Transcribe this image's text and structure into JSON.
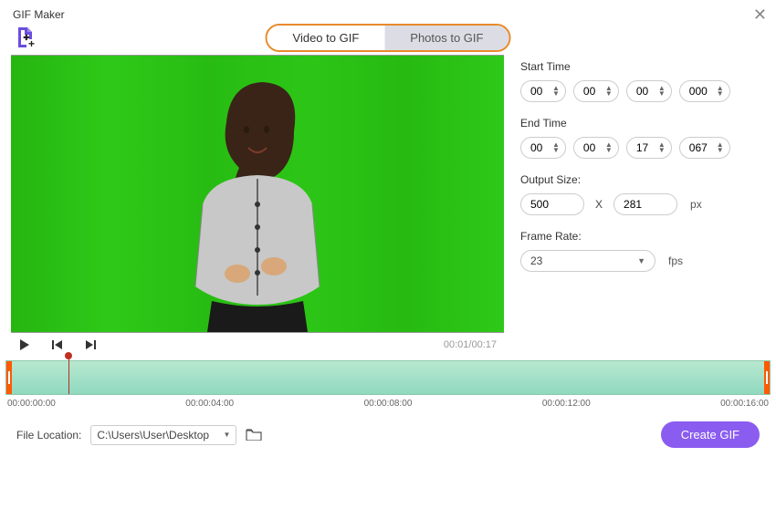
{
  "window": {
    "title": "GIF Maker"
  },
  "tabs": {
    "video": "Video to GIF",
    "photos": "Photos to GIF"
  },
  "settings": {
    "start_label": "Start Time",
    "end_label": "End Time",
    "start": {
      "h": "00",
      "m": "00",
      "s": "00",
      "ms": "000"
    },
    "end": {
      "h": "00",
      "m": "00",
      "s": "17",
      "ms": "067"
    },
    "output_label": "Output Size:",
    "output": {
      "w": "500",
      "h": "281",
      "unit": "px"
    },
    "size_sep": "X",
    "frame_label": "Frame Rate:",
    "frame_rate": "23",
    "fps_unit": "fps"
  },
  "playback": {
    "time": "00:01/00:17"
  },
  "timeline": {
    "ticks": [
      "00:00:00:00",
      "00:00:04:00",
      "00:00:08:00",
      "00:00:12:00",
      "00:00:16:00"
    ]
  },
  "footer": {
    "file_label": "File Location:",
    "path": "C:\\Users\\User\\Desktop",
    "create": "Create GIF"
  }
}
